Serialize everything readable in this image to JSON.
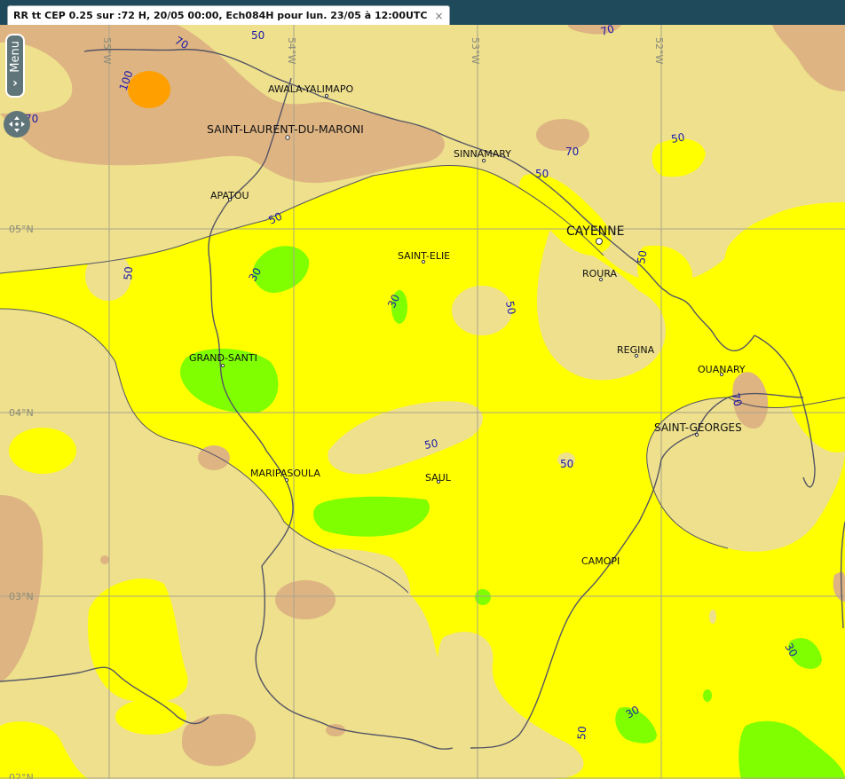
{
  "tab": {
    "title": "RR tt CEP 0.25 sur :72 H, 20/05 00:00, Ech084H pour lun. 23/05 à 12:00UTC",
    "close_glyph": "×"
  },
  "menu": {
    "label": "Menu",
    "chevron": "›"
  },
  "pan_control": {
    "icon": "pan-arrows-icon"
  },
  "colors": {
    "c_lt30": "#eee08c",
    "c_30_50": "#ffff00",
    "c_50_70": "#eee08c",
    "c_70_100": "#deb482",
    "c_100": "#ffa000",
    "c_green": "#80ff00",
    "border": "#555566"
  },
  "map": {
    "grid_labels": {
      "lon55": "55°W",
      "lon54": "54°W",
      "lon53": "53°W",
      "lon52": "52°W",
      "lat5": "05°N",
      "lat4": "04°N",
      "lat3": "03°N",
      "lat2": "02°N"
    },
    "cities": {
      "awala": "AWALA-YALIMAPO",
      "saint_laurent": "SAINT-LAURENT-DU-MARONI",
      "sinnamary": "SINNAMARY",
      "apatou": "APATOU",
      "cayenne": "CAYENNE",
      "saint_elie": "SAINT-ELIE",
      "roura": "ROURA",
      "regina": "REGINA",
      "ouanary": "OUANARY",
      "grand_santi": "GRAND-SANTI",
      "saint_georges": "SAINT-GEORGES",
      "maripasoula": "MARIPASOULA",
      "saul": "SAUL",
      "camopi": "CAMOPI"
    },
    "contour_labels": {
      "l50_top": "50",
      "l70_top": "70",
      "l70_topright": "70",
      "l100": "100",
      "l70_left": "70",
      "l50_ne": "50",
      "l70_cayenne": "70",
      "l50_sinnamary": "50",
      "l50_apatou": "50",
      "l50_roura": "50",
      "l50_west": "50",
      "l30_west": "30",
      "l30_center": "30",
      "l50_center": "50",
      "l70_ouanary": "70",
      "l50_saul": "50",
      "l50_small": "50",
      "l30_se": "30",
      "l30_south": "30",
      "l50_south": "50"
    }
  }
}
